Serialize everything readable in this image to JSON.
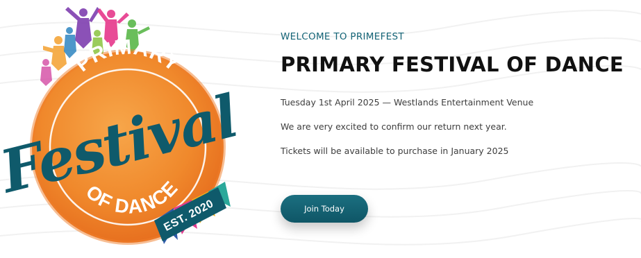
{
  "logo": {
    "line1": "PRIMARY",
    "script": "Festival",
    "line2": "OF DANCE",
    "est": "EST. 2020"
  },
  "hero": {
    "eyebrow": "WELCOME TO PRIMEFEST",
    "title": "PRIMARY FESTIVAL OF DANCE",
    "date_venue": "Tuesday 1st April 2025 — Westlands Entertainment Venue",
    "message": "We are very excited to confirm our return next year.",
    "tickets": "Tickets will be available to purchase in January 2025",
    "cta_label": "Join Today"
  },
  "colors": {
    "accent_teal": "#0f5a6b",
    "orange": "#f0892c",
    "text_dark": "#111111"
  }
}
